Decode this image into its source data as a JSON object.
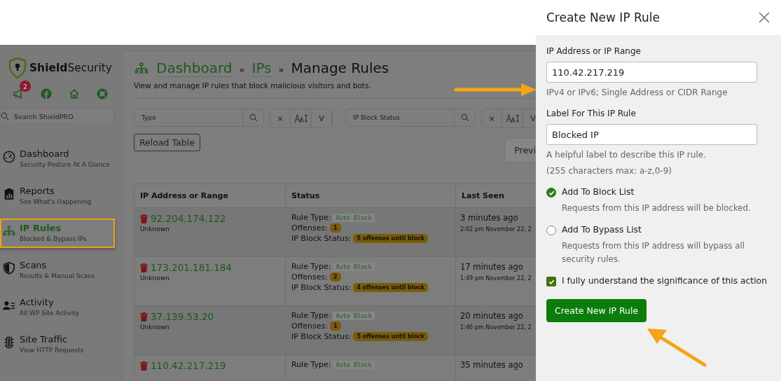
{
  "sidebar": {
    "brand": "**Shield**Security",
    "notification_count": "2",
    "search": {
      "placeholder": "Search ShieldPRO"
    },
    "items": [
      {
        "title": "Dashboard",
        "subtitle": "Security Posture At A Glance",
        "selected": false
      },
      {
        "title": "Reports",
        "subtitle": "See What's Happening",
        "selected": false
      },
      {
        "title": "IP Rules",
        "subtitle": "Blocked & Bypass IPs",
        "selected": true
      },
      {
        "title": "Scans",
        "subtitle": "Results & Manual Scans",
        "selected": false
      },
      {
        "title": "Activity",
        "subtitle": "All WP Site Activity",
        "selected": false
      },
      {
        "title": "Site Traffic",
        "subtitle": "View HTTP Requests",
        "selected": false
      }
    ]
  },
  "header": {
    "breadcrumbs": [
      {
        "label": "Dashboard",
        "kind": "link"
      },
      {
        "label": "IPs",
        "kind": "link"
      },
      {
        "label": "Manage Rules",
        "kind": "current"
      }
    ],
    "separator": "»",
    "description": "View and manage IP rules that block malicious visitors and bots."
  },
  "filters": [
    {
      "placeholder": "Type",
      "clear": "×",
      "toggle": "V"
    },
    {
      "placeholder": "IP Block Status",
      "clear": "×",
      "toggle": "V"
    }
  ],
  "reload_button": "Reload Table",
  "pager_button": "Previ",
  "table": {
    "columns": [
      "IP Address or Range",
      "Status",
      "Last Seen"
    ],
    "rows": [
      {
        "ip": "92.204.174.122",
        "location": "Unknown",
        "rule_type_label": "Rule Type:",
        "rule_type": "Auto Block",
        "offenses_label": "Offenses:",
        "offenses": "1",
        "block_status_label": "IP Block Status:",
        "block_status": "5 offenses until block",
        "last_seen": "3 minutes ago",
        "timestamp": "2:02 pm November 22, 2"
      },
      {
        "ip": "173.201.181.184",
        "location": "Unknown",
        "rule_type_label": "Rule Type:",
        "rule_type": "Auto Block",
        "offenses_label": "Offenses:",
        "offenses": "2",
        "block_status_label": "IP Block Status:",
        "block_status": "4 offenses until block",
        "last_seen": "17 minutes ago",
        "timestamp": "1:49 pm November 22, 2"
      },
      {
        "ip": "37.139.53.20",
        "location": "Unknown",
        "rule_type_label": "Rule Type:",
        "rule_type": "Auto Block",
        "offenses_label": "Offenses:",
        "offenses": "1",
        "block_status_label": "IP Block Status:",
        "block_status": "5 offenses until block",
        "last_seen": "20 minutes ago",
        "timestamp": "1:46 pm November 22, 2"
      },
      {
        "ip": "110.42.217.219",
        "rule_type_label": "Rule Type:",
        "rule_type": "Auto Block",
        "last_seen": "35 minutes ago"
      }
    ]
  },
  "modal": {
    "title": "Create New IP Rule",
    "fields": [
      {
        "label": "IP Address or IP Range",
        "value": "110.42.217.219",
        "help": [
          "IPv4 or IPv6; Single Address or CIDR Range"
        ]
      },
      {
        "label": "Label For This IP Rule",
        "value": "Blocked IP",
        "help": [
          "A helpful label to describe this IP rule.",
          "(255 characters max: a-z,0-9)"
        ]
      }
    ],
    "options": [
      {
        "label": "Add To Block List",
        "description": "Requests from this IP address will be blocked.",
        "selected": true
      },
      {
        "label": "Add To Bypass List",
        "description": "Requests from this IP address will bypass all security rules.",
        "selected": false
      }
    ],
    "confirm": {
      "label": "I fully understand the significance of this action",
      "checked": true
    },
    "submit": "Create New IP Rule"
  }
}
